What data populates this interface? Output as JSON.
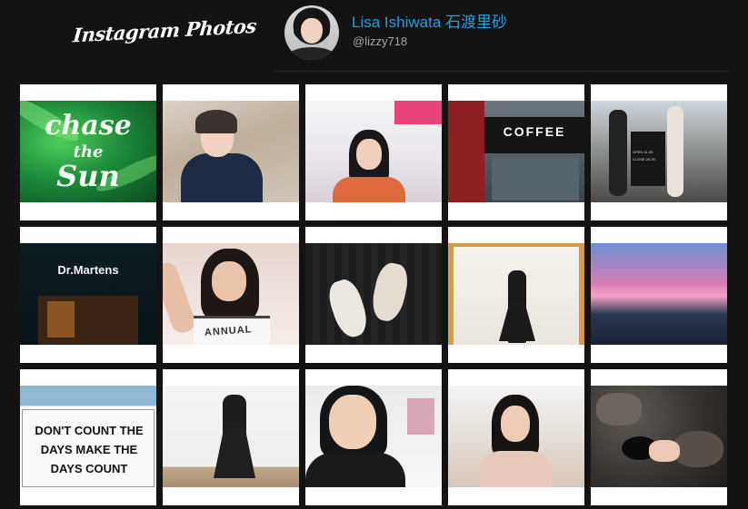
{
  "header": {
    "logo_text": "Instagram Photos",
    "profile": {
      "name": "Lisa Ishiwata 石渡里砂",
      "handle": "@lizzy718",
      "name_color": "#1aa3e0"
    }
  },
  "photos": [
    {
      "text": [
        "chase",
        "the",
        "Sun"
      ]
    },
    {
      "text": []
    },
    {
      "text": []
    },
    {
      "text": [
        "COFFEE"
      ]
    },
    {
      "text": [
        "OPEN 11-00",
        "CLOSE 20-00"
      ]
    },
    {
      "text": [
        "Dr.Martens"
      ]
    },
    {
      "text": [
        "ANNUAL"
      ]
    },
    {
      "text": []
    },
    {
      "text": []
    },
    {
      "text": []
    },
    {
      "text": [
        "DON'T COUNT THE",
        "DAYS MAKE THE",
        "DAYS COUNT"
      ]
    },
    {
      "text": []
    },
    {
      "text": []
    },
    {
      "text": []
    },
    {
      "text": []
    }
  ]
}
